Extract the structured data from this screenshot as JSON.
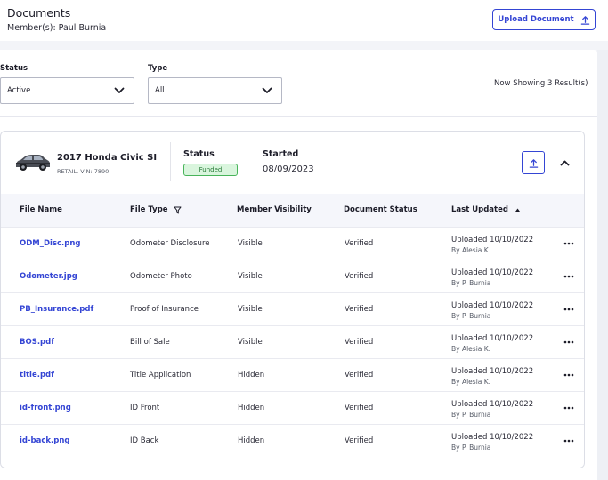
{
  "header": {
    "title": "Documents",
    "members": "Member(s): Paul Burnia",
    "upload_label": "Upload Document"
  },
  "filters": {
    "status_label": "Status",
    "status_value": "Active",
    "type_label": "Type",
    "type_value": "All",
    "results_text": "Now Showing 3 Result(s)"
  },
  "vehicle": {
    "name": "2017 Honda Civic SI",
    "vin": "RETAIL. VIN: 7890",
    "status_label": "Status",
    "status_badge": "Funded",
    "started_label": "Started",
    "started_date": "08/09/2023"
  },
  "table": {
    "columns": [
      "File Name",
      "File Type",
      "Member Visibility",
      "Document Status",
      "Last Updated"
    ],
    "rows": [
      {
        "file": "ODM_Disc.png",
        "type": "Odometer Disclosure",
        "visibility": "Visible",
        "status": "Verified",
        "updated": "Uploaded 10/10/2022",
        "by": "By Alesia K."
      },
      {
        "file": "Odometer.jpg",
        "type": "Odometer Photo",
        "visibility": "Visible",
        "status": "Verified",
        "updated": "Uploaded 10/10/2022",
        "by": "By P. Burnia"
      },
      {
        "file": "PB_Insurance.pdf",
        "type": "Proof of Insurance",
        "visibility": "Visible",
        "status": "Verified",
        "updated": "Uploaded 10/10/2022",
        "by": "By P. Burnia"
      },
      {
        "file": "BOS.pdf",
        "type": "Bill of Sale",
        "visibility": "Visible",
        "status": "Verified",
        "updated": "Uploaded 10/10/2022",
        "by": "By Alesia K."
      },
      {
        "file": "title.pdf",
        "type": "Title Application",
        "visibility": "Hidden",
        "status": "Verified",
        "updated": "Uploaded 10/10/2022",
        "by": "By Alesia K."
      },
      {
        "file": "id-front.png",
        "type": "ID Front",
        "visibility": "Hidden",
        "status": "Verified",
        "updated": "Uploaded 10/10/2022",
        "by": "By P. Burnia"
      },
      {
        "file": "id-back.png",
        "type": "ID Back",
        "visibility": "Hidden",
        "status": "Verified",
        "updated": "Uploaded 10/10/2022",
        "by": "By P. Burnia"
      }
    ]
  },
  "icons": {
    "upload": "upload-arrow-icon",
    "chevron_down": "chevron-down-icon",
    "chevron_up": "chevron-up-icon",
    "filter": "filter-funnel-icon",
    "sort": "sort-asc-icon",
    "more": "more-horizontal-icon",
    "car": "car-icon"
  },
  "colors": {
    "accent": "#3445d4",
    "badge_bg": "#d9f5dd",
    "badge_border": "#48b45a",
    "badge_text": "#267a36"
  }
}
